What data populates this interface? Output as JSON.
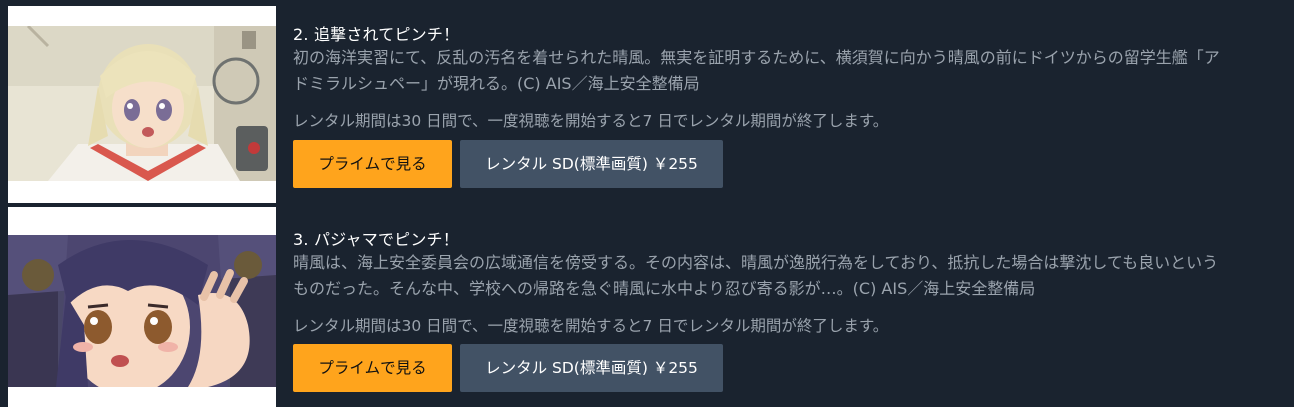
{
  "episodes": [
    {
      "title": "2. 追撃されてピンチ！",
      "synopsis_line1": "初の海洋実習にて、反乱の汚名を着せられた晴風。無実を証明するために、横須賀に向かう晴風の前にドイツからの留学生艦「ア",
      "synopsis_line2": "ドミラルシュペー」が現れる。(C) AIS／海上安全整備局",
      "rental_info": "レンタル期間は30 日間で、一度視聴を開始すると7 日でレンタル期間が終了します。",
      "prime_button_label": "プライムで見る",
      "rent_button_label": "レンタル SD(標準画質)  ￥255"
    },
    {
      "title": "3. パジャマでピンチ！",
      "synopsis_line1": "晴風は、海上安全委員会の広域通信を傍受する。その内容は、晴風が逸脱行為をしており、抵抗した場合は撃沈しても良いという",
      "synopsis_line2": "ものだった。そんな中、学校への帰路を急ぐ晴風に水中より忍び寄る影が…。(C) AIS／海上安全整備局",
      "rental_info": "レンタル期間は30 日間で、一度視聴を開始すると7 日でレンタル期間が終了します。",
      "prime_button_label": "プライムで見る",
      "rent_button_label": "レンタル SD(標準画質)  ￥255"
    }
  ],
  "colors": {
    "page_background": "#1a232f",
    "prime_button": "#ffa41c",
    "rent_button": "#425265",
    "title_text": "#ffffff",
    "synopsis_text": "#9aa3ad"
  }
}
